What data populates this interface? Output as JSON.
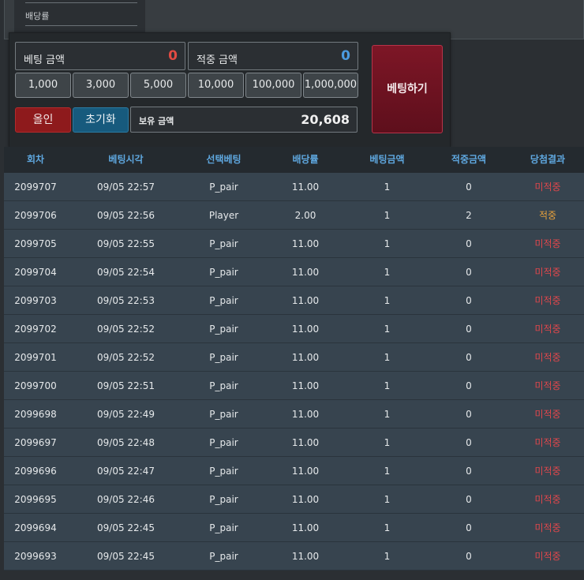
{
  "odds_label": "배당률",
  "bet_amount": {
    "label": "베팅 금액",
    "value": "0",
    "color": "#e24b43"
  },
  "win_amount": {
    "label": "적중 금액",
    "value": "0",
    "color": "#4b9be0"
  },
  "chips": [
    "1,000",
    "3,000",
    "5,000",
    "10,000",
    "100,000",
    "1,000,000"
  ],
  "buttons": {
    "all_in": "올인",
    "reset": "초기화",
    "place_bet": "베팅하기"
  },
  "balance": {
    "label": "보유 금액",
    "value": "20,608"
  },
  "table": {
    "headers": [
      "회차",
      "베팅시각",
      "선택베팅",
      "배당률",
      "베팅금액",
      "적중금액",
      "당첨결과"
    ],
    "rows": [
      [
        "2099707",
        "09/05 22:57",
        "P_pair",
        "11.00",
        "1",
        "0",
        "미적중"
      ],
      [
        "2099706",
        "09/05 22:56",
        "Player",
        "2.00",
        "1",
        "2",
        "적중"
      ],
      [
        "2099705",
        "09/05 22:55",
        "P_pair",
        "11.00",
        "1",
        "0",
        "미적중"
      ],
      [
        "2099704",
        "09/05 22:54",
        "P_pair",
        "11.00",
        "1",
        "0",
        "미적중"
      ],
      [
        "2099703",
        "09/05 22:53",
        "P_pair",
        "11.00",
        "1",
        "0",
        "미적중"
      ],
      [
        "2099702",
        "09/05 22:52",
        "P_pair",
        "11.00",
        "1",
        "0",
        "미적중"
      ],
      [
        "2099701",
        "09/05 22:52",
        "P_pair",
        "11.00",
        "1",
        "0",
        "미적중"
      ],
      [
        "2099700",
        "09/05 22:51",
        "P_pair",
        "11.00",
        "1",
        "0",
        "미적중"
      ],
      [
        "2099698",
        "09/05 22:49",
        "P_pair",
        "11.00",
        "1",
        "0",
        "미적중"
      ],
      [
        "2099697",
        "09/05 22:48",
        "P_pair",
        "11.00",
        "1",
        "0",
        "미적중"
      ],
      [
        "2099696",
        "09/05 22:47",
        "P_pair",
        "11.00",
        "1",
        "0",
        "미적중"
      ],
      [
        "2099695",
        "09/05 22:46",
        "P_pair",
        "11.00",
        "1",
        "0",
        "미적중"
      ],
      [
        "2099694",
        "09/05 22:45",
        "P_pair",
        "11.00",
        "1",
        "0",
        "미적중"
      ],
      [
        "2099693",
        "09/05 22:45",
        "P_pair",
        "11.00",
        "1",
        "0",
        "미적중"
      ]
    ]
  }
}
